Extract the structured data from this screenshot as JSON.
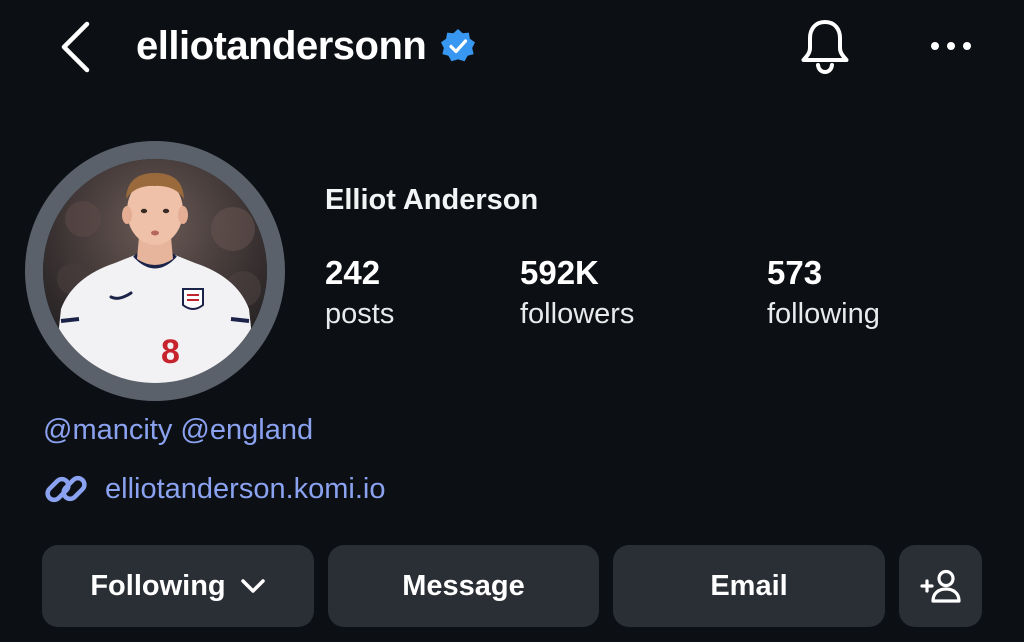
{
  "header": {
    "username": "elliotandersonn",
    "back_icon": "chevron-left-icon",
    "verified_icon": "verified-badge-icon",
    "notify_icon": "bell-icon",
    "more_icon": "more-horizontal-icon"
  },
  "profile": {
    "display_name": "Elliot Anderson",
    "avatar_alt": "profile-photo"
  },
  "stats": [
    {
      "value": "242",
      "label": "posts"
    },
    {
      "value": "592K",
      "label": "followers"
    },
    {
      "value": "573",
      "label": "following"
    }
  ],
  "bio": {
    "mentions": [
      "@mancity",
      "@england"
    ],
    "link_icon": "link-icon",
    "link_text": "elliotanderson.komi.io"
  },
  "actions": {
    "following_label": "Following",
    "message_label": "Message",
    "email_label": "Email",
    "add_user_icon": "add-person-icon"
  },
  "colors": {
    "background": "#0c0f14",
    "button": "#2a2e35",
    "link": "#8aa2f0",
    "verified": "#3897f0",
    "avatar_ring": "#5b616b"
  }
}
